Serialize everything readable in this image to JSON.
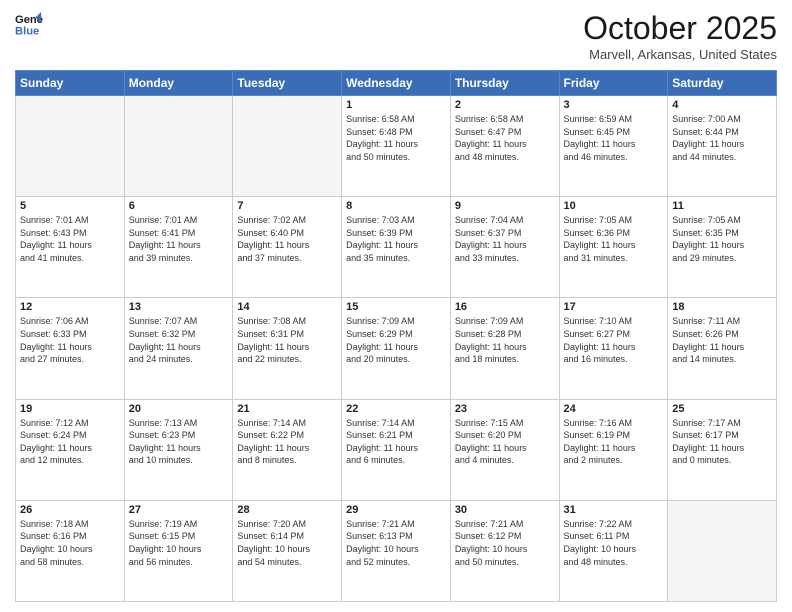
{
  "header": {
    "logo_line1": "General",
    "logo_line2": "Blue",
    "month": "October 2025",
    "location": "Marvell, Arkansas, United States"
  },
  "weekdays": [
    "Sunday",
    "Monday",
    "Tuesday",
    "Wednesday",
    "Thursday",
    "Friday",
    "Saturday"
  ],
  "weeks": [
    [
      {
        "day": "",
        "info": ""
      },
      {
        "day": "",
        "info": ""
      },
      {
        "day": "",
        "info": ""
      },
      {
        "day": "1",
        "info": "Sunrise: 6:58 AM\nSunset: 6:48 PM\nDaylight: 11 hours\nand 50 minutes."
      },
      {
        "day": "2",
        "info": "Sunrise: 6:58 AM\nSunset: 6:47 PM\nDaylight: 11 hours\nand 48 minutes."
      },
      {
        "day": "3",
        "info": "Sunrise: 6:59 AM\nSunset: 6:45 PM\nDaylight: 11 hours\nand 46 minutes."
      },
      {
        "day": "4",
        "info": "Sunrise: 7:00 AM\nSunset: 6:44 PM\nDaylight: 11 hours\nand 44 minutes."
      }
    ],
    [
      {
        "day": "5",
        "info": "Sunrise: 7:01 AM\nSunset: 6:43 PM\nDaylight: 11 hours\nand 41 minutes."
      },
      {
        "day": "6",
        "info": "Sunrise: 7:01 AM\nSunset: 6:41 PM\nDaylight: 11 hours\nand 39 minutes."
      },
      {
        "day": "7",
        "info": "Sunrise: 7:02 AM\nSunset: 6:40 PM\nDaylight: 11 hours\nand 37 minutes."
      },
      {
        "day": "8",
        "info": "Sunrise: 7:03 AM\nSunset: 6:39 PM\nDaylight: 11 hours\nand 35 minutes."
      },
      {
        "day": "9",
        "info": "Sunrise: 7:04 AM\nSunset: 6:37 PM\nDaylight: 11 hours\nand 33 minutes."
      },
      {
        "day": "10",
        "info": "Sunrise: 7:05 AM\nSunset: 6:36 PM\nDaylight: 11 hours\nand 31 minutes."
      },
      {
        "day": "11",
        "info": "Sunrise: 7:05 AM\nSunset: 6:35 PM\nDaylight: 11 hours\nand 29 minutes."
      }
    ],
    [
      {
        "day": "12",
        "info": "Sunrise: 7:06 AM\nSunset: 6:33 PM\nDaylight: 11 hours\nand 27 minutes."
      },
      {
        "day": "13",
        "info": "Sunrise: 7:07 AM\nSunset: 6:32 PM\nDaylight: 11 hours\nand 24 minutes."
      },
      {
        "day": "14",
        "info": "Sunrise: 7:08 AM\nSunset: 6:31 PM\nDaylight: 11 hours\nand 22 minutes."
      },
      {
        "day": "15",
        "info": "Sunrise: 7:09 AM\nSunset: 6:29 PM\nDaylight: 11 hours\nand 20 minutes."
      },
      {
        "day": "16",
        "info": "Sunrise: 7:09 AM\nSunset: 6:28 PM\nDaylight: 11 hours\nand 18 minutes."
      },
      {
        "day": "17",
        "info": "Sunrise: 7:10 AM\nSunset: 6:27 PM\nDaylight: 11 hours\nand 16 minutes."
      },
      {
        "day": "18",
        "info": "Sunrise: 7:11 AM\nSunset: 6:26 PM\nDaylight: 11 hours\nand 14 minutes."
      }
    ],
    [
      {
        "day": "19",
        "info": "Sunrise: 7:12 AM\nSunset: 6:24 PM\nDaylight: 11 hours\nand 12 minutes."
      },
      {
        "day": "20",
        "info": "Sunrise: 7:13 AM\nSunset: 6:23 PM\nDaylight: 11 hours\nand 10 minutes."
      },
      {
        "day": "21",
        "info": "Sunrise: 7:14 AM\nSunset: 6:22 PM\nDaylight: 11 hours\nand 8 minutes."
      },
      {
        "day": "22",
        "info": "Sunrise: 7:14 AM\nSunset: 6:21 PM\nDaylight: 11 hours\nand 6 minutes."
      },
      {
        "day": "23",
        "info": "Sunrise: 7:15 AM\nSunset: 6:20 PM\nDaylight: 11 hours\nand 4 minutes."
      },
      {
        "day": "24",
        "info": "Sunrise: 7:16 AM\nSunset: 6:19 PM\nDaylight: 11 hours\nand 2 minutes."
      },
      {
        "day": "25",
        "info": "Sunrise: 7:17 AM\nSunset: 6:17 PM\nDaylight: 11 hours\nand 0 minutes."
      }
    ],
    [
      {
        "day": "26",
        "info": "Sunrise: 7:18 AM\nSunset: 6:16 PM\nDaylight: 10 hours\nand 58 minutes."
      },
      {
        "day": "27",
        "info": "Sunrise: 7:19 AM\nSunset: 6:15 PM\nDaylight: 10 hours\nand 56 minutes."
      },
      {
        "day": "28",
        "info": "Sunrise: 7:20 AM\nSunset: 6:14 PM\nDaylight: 10 hours\nand 54 minutes."
      },
      {
        "day": "29",
        "info": "Sunrise: 7:21 AM\nSunset: 6:13 PM\nDaylight: 10 hours\nand 52 minutes."
      },
      {
        "day": "30",
        "info": "Sunrise: 7:21 AM\nSunset: 6:12 PM\nDaylight: 10 hours\nand 50 minutes."
      },
      {
        "day": "31",
        "info": "Sunrise: 7:22 AM\nSunset: 6:11 PM\nDaylight: 10 hours\nand 48 minutes."
      },
      {
        "day": "",
        "info": ""
      }
    ]
  ]
}
